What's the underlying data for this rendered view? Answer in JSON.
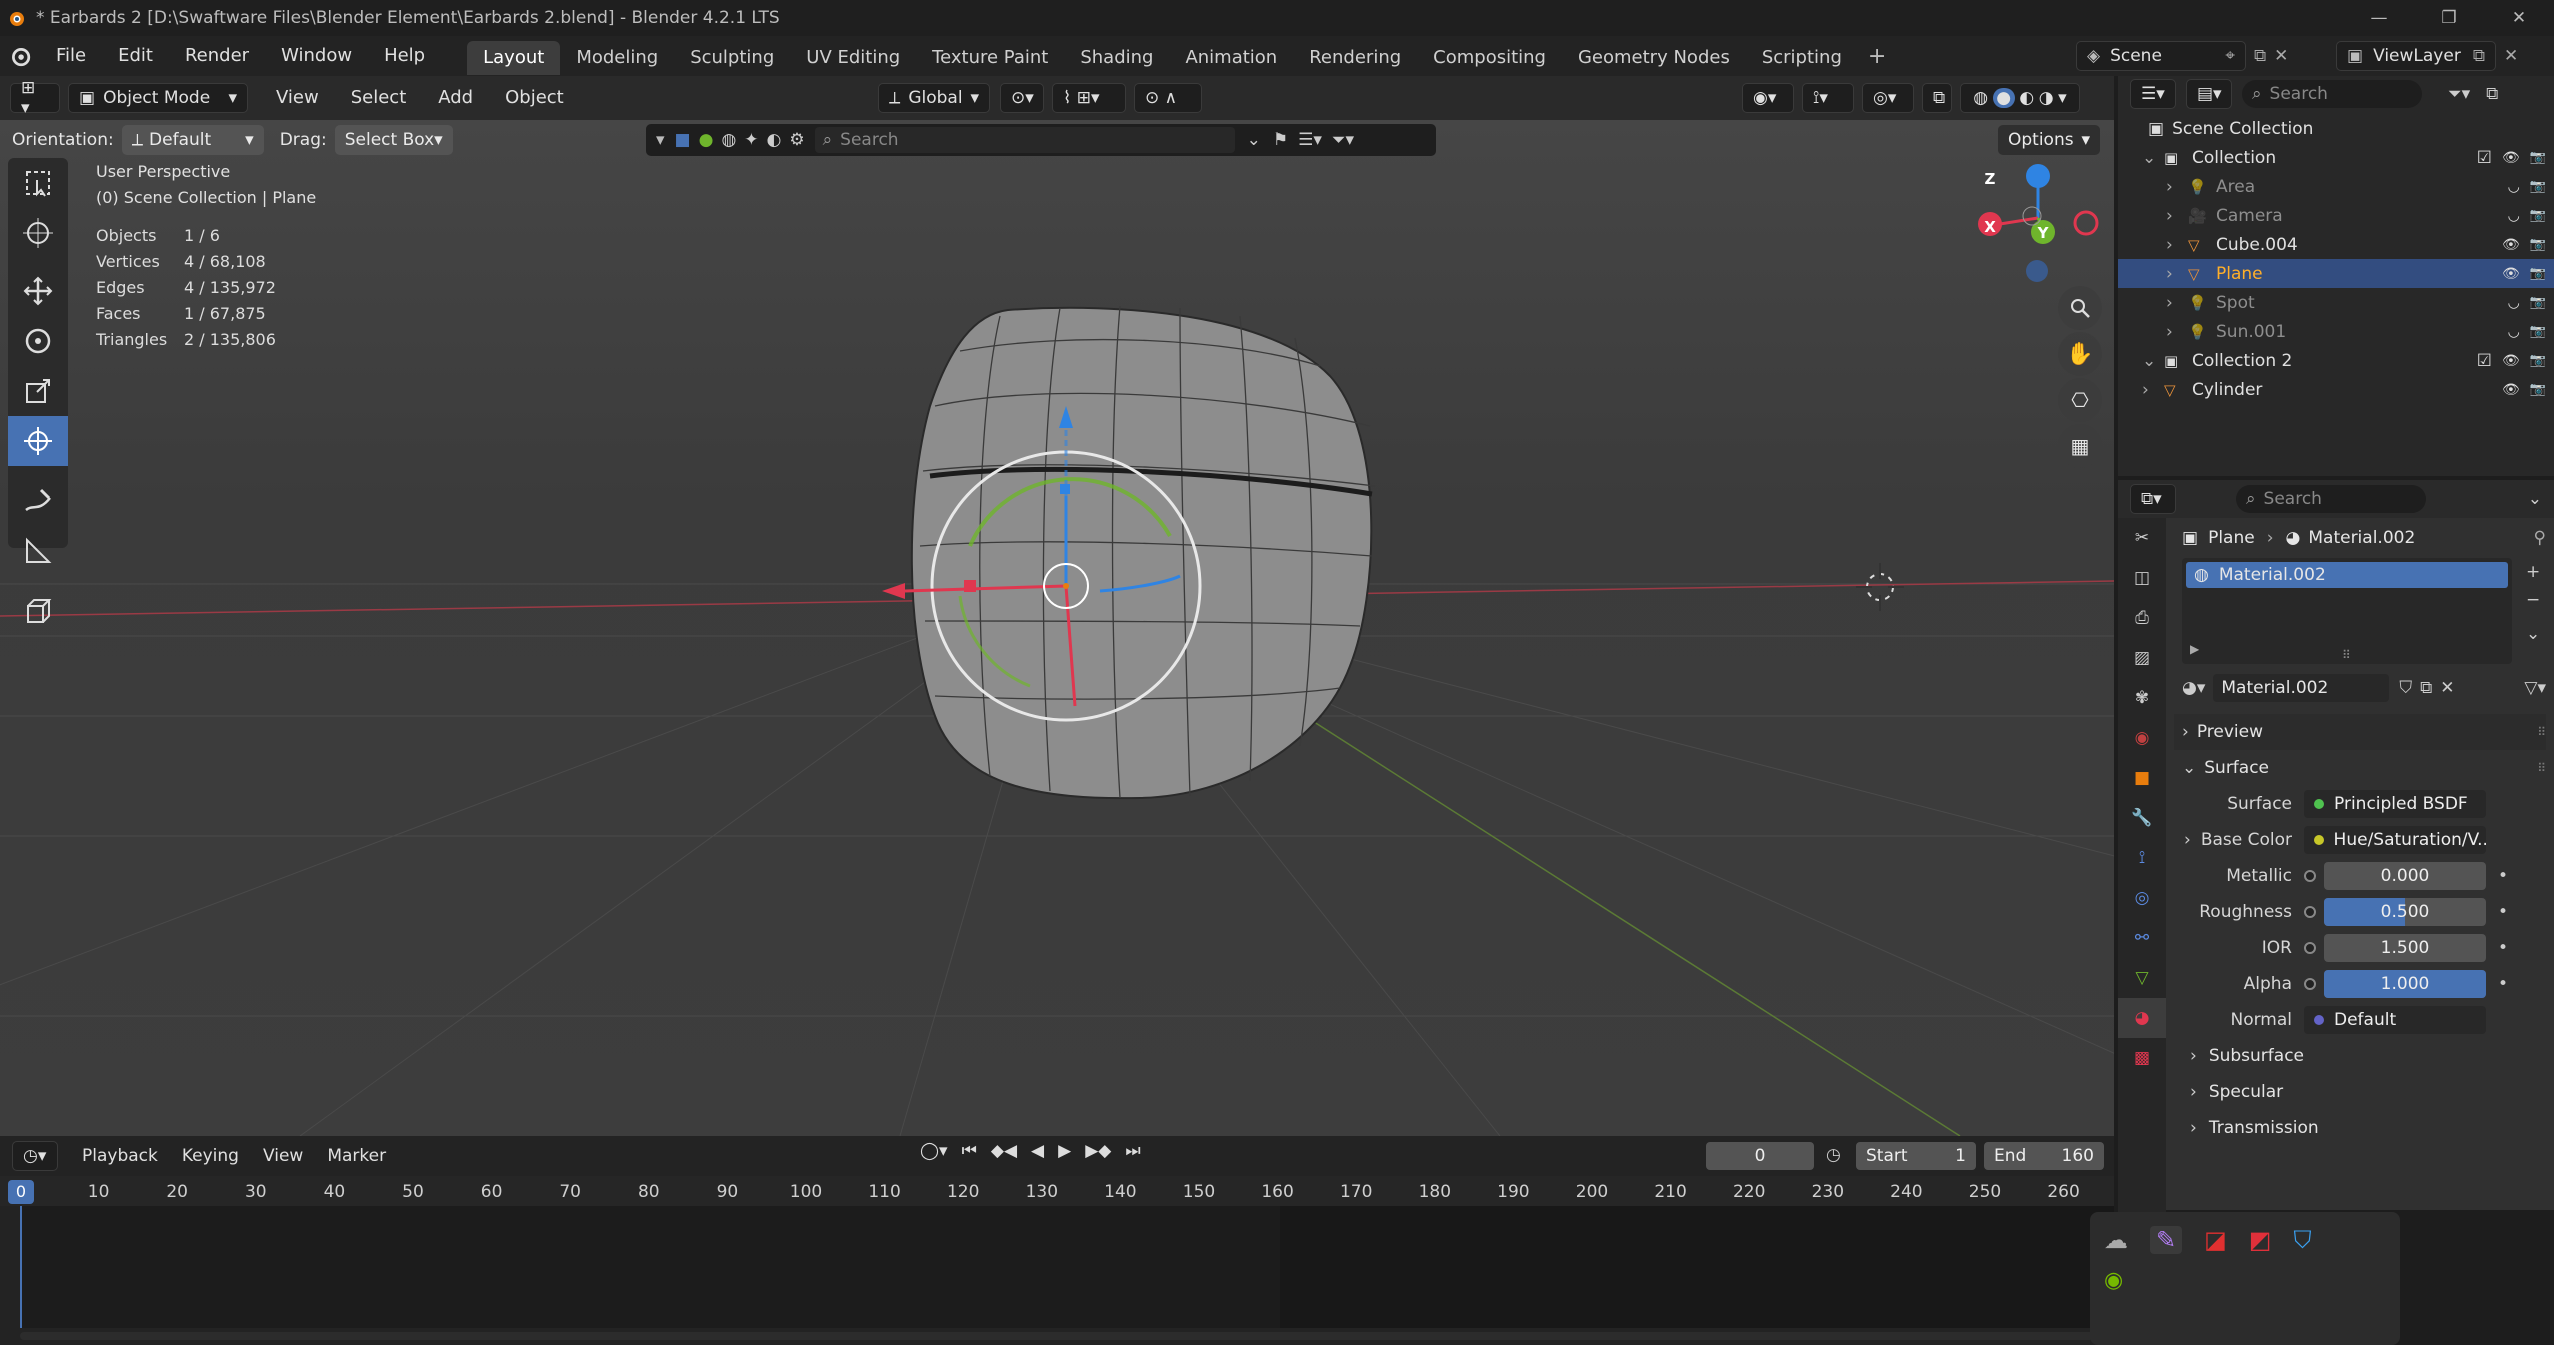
{
  "titlebar": {
    "text": "* Earbards 2 [D:\\Swaftware Files\\Blender Element\\Earbards 2.blend] - Blender 4.2.1 LTS"
  },
  "menu": [
    "File",
    "Edit",
    "Render",
    "Window",
    "Help"
  ],
  "workspaces": [
    "Layout",
    "Modeling",
    "Sculpting",
    "UV Editing",
    "Texture Paint",
    "Shading",
    "Animation",
    "Rendering",
    "Compositing",
    "Geometry Nodes",
    "Scripting"
  ],
  "scene": {
    "name": "Scene",
    "view_layer": "ViewLayer"
  },
  "viewport": {
    "mode": "Object Mode",
    "menus": [
      "View",
      "Select",
      "Add",
      "Object"
    ],
    "transform": "Global",
    "orientation_label": "Orientation:",
    "orientation": "Default",
    "drag_label": "Drag:",
    "drag": "Select Box",
    "search_placeholder": "Search",
    "options": "Options",
    "view_name": "User Perspective",
    "collection_path": "(0) Scene Collection | Plane",
    "stats": [
      {
        "k": "Objects",
        "v": "1 / 6"
      },
      {
        "k": "Vertices",
        "v": "4 / 68,108"
      },
      {
        "k": "Edges",
        "v": "4 / 135,972"
      },
      {
        "k": "Faces",
        "v": "1 / 67,875"
      },
      {
        "k": "Triangles",
        "v": "2 / 135,806"
      }
    ],
    "gizmo": {
      "x": "X",
      "y": "Y",
      "z": "Z"
    }
  },
  "outliner": {
    "search_placeholder": "Search",
    "root": "Scene Collection",
    "items": [
      {
        "name": "Collection",
        "level": 1,
        "type": "collection"
      },
      {
        "name": "Area",
        "level": 2,
        "type": "light",
        "dim": true
      },
      {
        "name": "Camera",
        "level": 2,
        "type": "camera",
        "dim": true
      },
      {
        "name": "Cube.004",
        "level": 2,
        "type": "mesh"
      },
      {
        "name": "Plane",
        "level": 2,
        "type": "mesh",
        "selected": true
      },
      {
        "name": "Spot",
        "level": 2,
        "type": "light",
        "dim": true
      },
      {
        "name": "Sun.001",
        "level": 2,
        "type": "light",
        "dim": true
      },
      {
        "name": "Collection 2",
        "level": 1,
        "type": "collection"
      },
      {
        "name": "Cylinder",
        "level": 1,
        "type": "mesh"
      }
    ]
  },
  "properties": {
    "search_placeholder": "Search",
    "breadcrumb_object": "Plane",
    "breadcrumb_material": "Material.002",
    "slot": "Material.002",
    "material_name": "Material.002",
    "sections": {
      "preview": "Preview",
      "surface": "Surface"
    },
    "fields": [
      {
        "label": "Surface",
        "type": "node",
        "value": "Principled BSDF",
        "color": "#4fc24f"
      },
      {
        "label": "Base Color",
        "type": "node",
        "value": "Hue/Saturation/V...",
        "color": "#c7c729",
        "expand": true
      },
      {
        "label": "Metallic",
        "type": "num",
        "value": "0.000",
        "fill": 0.0
      },
      {
        "label": "Roughness",
        "type": "num",
        "value": "0.500",
        "fill": 0.5
      },
      {
        "label": "IOR",
        "type": "num",
        "value": "1.500",
        "fill": 0.0
      },
      {
        "label": "Alpha",
        "type": "num",
        "value": "1.000",
        "fill": 1.0
      },
      {
        "label": "Normal",
        "type": "node",
        "value": "Default",
        "color": "#6363c7"
      }
    ],
    "subsections": [
      "Subsurface",
      "Specular",
      "Transmission"
    ]
  },
  "timeline": {
    "menus": [
      "Playback",
      "Keying",
      "View",
      "Marker"
    ],
    "current": "0",
    "start_label": "Start",
    "start": "1",
    "end_label": "End",
    "end": "160",
    "ticks": [
      "0",
      "10",
      "20",
      "30",
      "40",
      "50",
      "60",
      "70",
      "80",
      "90",
      "100",
      "110",
      "120",
      "130",
      "140",
      "150",
      "160",
      "170",
      "180",
      "190",
      "200",
      "210",
      "220",
      "230",
      "240",
      "250",
      "260"
    ]
  },
  "colors": {
    "accent": "#4772b3",
    "selected_row": "#334d80",
    "x_axis": "#e0374f",
    "y_axis": "#6fb52c",
    "z_axis": "#2f84e3"
  }
}
